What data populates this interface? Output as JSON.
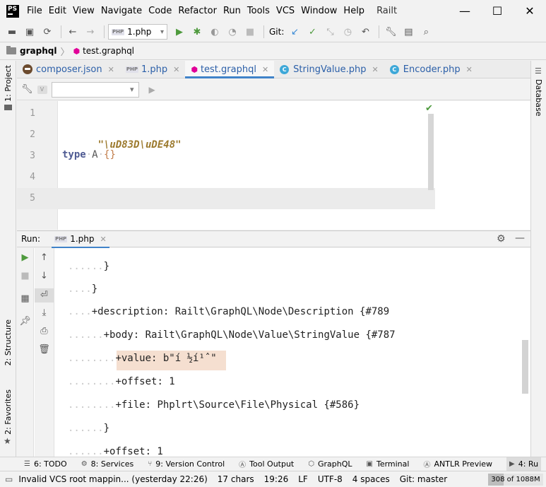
{
  "menu": {
    "logo": "PS",
    "items": [
      "File",
      "Edit",
      "View",
      "Navigate",
      "Code",
      "Refactor",
      "Run",
      "Tools",
      "VCS",
      "Window",
      "Help"
    ],
    "window_title": "Railt"
  },
  "toolbar": {
    "run_config": "1.php",
    "git_label": "Git:"
  },
  "breadcrumb": {
    "project": "graphql",
    "file": "test.graphql"
  },
  "side_tabs": {
    "project": "1: Project",
    "structure": "2: Structure",
    "favorites": "2: Favorites",
    "database": "Database"
  },
  "editor_tabs": [
    {
      "label": "composer.json",
      "icon": "composer-icon"
    },
    {
      "label": "1.php",
      "icon": "php-icon"
    },
    {
      "label": "test.graphql",
      "icon": "graphql-icon",
      "active": true
    },
    {
      "label": "StringValue.php",
      "icon": "class-icon"
    },
    {
      "label": "Encoder.php",
      "icon": "class-icon"
    }
  ],
  "editor": {
    "line_numbers": [
      "1",
      "2",
      "3",
      "4",
      "5"
    ],
    "line2_string": "\"\\uD83D\\uDE48\"",
    "line3_keyword": "type",
    "line3_name": "A",
    "line3_braces": "{}"
  },
  "run": {
    "label": "Run:",
    "tab": "1.php",
    "output_lines": [
      {
        "indent": "......",
        "text": "}"
      },
      {
        "indent": "....",
        "text": "}"
      },
      {
        "indent": "....",
        "text": "+description: Railt\\GraphQL\\Node\\Description {#789"
      },
      {
        "indent": "......",
        "text": "+body: Railt\\GraphQL\\Node\\Value\\StringValue {#787"
      },
      {
        "indent": "........",
        "text": "+value: b\"í ½í¹ˆ\""
      },
      {
        "indent": "........",
        "text": "+offset: 1"
      },
      {
        "indent": "........",
        "text": "+file: Phplrt\\Source\\File\\Physical {#586}"
      },
      {
        "indent": "......",
        "text": "}"
      },
      {
        "indent": "......",
        "text": "+offset: 1"
      }
    ]
  },
  "bottom_tabs": [
    {
      "label": "6: TODO",
      "icon": "list-icon"
    },
    {
      "label": "8: Services",
      "icon": "services-icon"
    },
    {
      "label": "9: Version Control",
      "icon": "vcs-icon"
    },
    {
      "label": "Tool Output",
      "icon": "tool-output-icon"
    },
    {
      "label": "GraphQL",
      "icon": "graphql-icon"
    },
    {
      "label": "Terminal",
      "icon": "terminal-icon"
    },
    {
      "label": "ANTLR Preview",
      "icon": "antlr-icon"
    },
    {
      "label": "4: Ru",
      "icon": "run-icon"
    }
  ],
  "status": {
    "message": "Invalid VCS root mappin... (yesterday 22:26)",
    "chars": "17 chars",
    "position": "19:26",
    "line_sep": "LF",
    "encoding": "UTF-8",
    "indent": "4 spaces",
    "branch": "Git: master",
    "memory": "308 of 1088M"
  },
  "colors": {
    "accent": "#4083c9",
    "run_green": "#4e9a3d",
    "graphql_pink": "#e10098",
    "highlight": "#f5dfd0"
  }
}
